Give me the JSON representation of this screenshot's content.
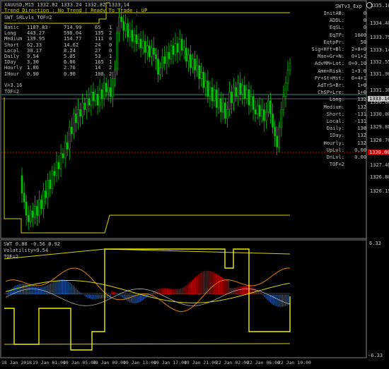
{
  "main_chart": {
    "symbol_line": "XAUUSD,M15  1332.82  1333.24  1332.82  1333.14",
    "trend_line": "Trend Direction : No Trend  |  Ready To Trade : UP",
    "panel_title": "SWT_SRLvls_TOF=2",
    "expert_label": "SWTv3_Exp",
    "table": {
      "rows": [
        {
          "name": "Basic",
          "c1": "1107.83",
          "c2": "714.99",
          "c3": "65",
          "c4": "1"
        },
        {
          "name": "Long",
          "c1": "443.27",
          "c2": "598.04",
          "c3": "135",
          "c4": "2"
        },
        {
          "name": "Medium",
          "c1": "139.95",
          "c2": "154.77",
          "c3": "111",
          "c4": "0"
        },
        {
          "name": "Short",
          "c1": "62.33",
          "c2": "14.62",
          "c3": "24",
          "c4": "0"
        },
        {
          "name": "Local",
          "c1": "30.17",
          "c2": "8.24",
          "c3": "27",
          "c4": "0"
        },
        {
          "name": "Daily",
          "c1": "9.54",
          "c2": "5.05",
          "c3": "53",
          "c4": "1"
        },
        {
          "name": "IDay",
          "c1": "3.30",
          "c2": "6.06",
          "c3": "165",
          "c4": "1"
        },
        {
          "name": "Hourly",
          "c1": "1.86",
          "c2": "2.76",
          "c3": "14",
          "c4": "2"
        },
        {
          "name": "IHour",
          "c1": "0.90",
          "c2": "0.90",
          "c3": "100",
          "c4": "2"
        }
      ],
      "v_line": "V=3.16",
      "tof_line": "TOF=2"
    },
    "right_panel": [
      {
        "k": "InitAB:",
        "v": "0"
      },
      {
        "k": "ADDL:",
        "v": "0"
      },
      {
        "k": "EqSL:",
        "v": "0"
      },
      {
        "k": "EqTP:",
        "v": "1600"
      },
      {
        "k": "EqtpPr:",
        "v": "50"
      },
      {
        "k": "Sig+Hft+Bl:",
        "v": "2+0+0"
      },
      {
        "k": "Man+Gr+N:",
        "v": "0+1+2"
      },
      {
        "k": "AdvMM+Lot:",
        "v": "0+0.10"
      },
      {
        "k": "Amm+Risk:",
        "v": "1+3.0"
      },
      {
        "k": "Pr+St+Mst:",
        "v": "6+4+1"
      },
      {
        "k": "AdTrS+Br:",
        "v": "1+0"
      },
      {
        "k": "ChSP+Lre:",
        "v": "1+0"
      },
      {
        "k": "Long:",
        "v": "132"
      },
      {
        "k": "Medium:",
        "v": "132"
      },
      {
        "k": "Short:",
        "v": "-131"
      },
      {
        "k": "Local:",
        "v": "-131"
      },
      {
        "k": "Daily:",
        "v": "130"
      },
      {
        "k": "IDay:",
        "v": "132"
      },
      {
        "k": "Hourly:",
        "v": "132"
      },
      {
        "k": "UpLvl:",
        "v": "0.00"
      },
      {
        "k": "DnLvl:",
        "v": "0.00"
      },
      {
        "k": "TOF=2",
        "v": ""
      }
    ],
    "price_axis": [
      "1335.25",
      "1334.50",
      "1333.75",
      "1333.00",
      "1332.25",
      "1331.50",
      "1330.75",
      "1330.00",
      "1329.25",
      "1328.50",
      "1327.75",
      "1327.00",
      "1326.25",
      "1325.50"
    ],
    "price_axis_ticks": [
      "1335.10",
      "1334.40",
      "1333.75",
      "1333.14",
      "1332.55",
      "1331.90",
      "1331.30",
      "1330.60",
      "1330.00",
      "1329.80",
      "1328.70",
      "1328.10",
      "1327.40",
      "1326.80",
      "1326.15"
    ],
    "current_price": "1333.14",
    "red_price": "1330.00",
    "colors": {
      "bull": "#00c800",
      "bear": "#00c800",
      "level_yellow": "#d4d400",
      "current_bg": "#c0c0c0",
      "red_level": "#c00000"
    }
  },
  "sub_chart": {
    "title_line": "SWT 0.88 -0.56 0.92",
    "volatility": "Volatility=9.54",
    "tof": "TOF=2",
    "axis_top": "6.33",
    "axis_bottom": "-6.33"
  },
  "x_axis": [
    "18 Jan 2018",
    "19 Jan 01:00",
    "19 Jan 05:00",
    "19 Jan 09:00",
    "19 Jan 13:00",
    "19 Jan 17:00",
    "19 Jan 21:00",
    "22 Jan 02:00",
    "22 Jan 06:00",
    "22 Jan 10:00"
  ]
}
